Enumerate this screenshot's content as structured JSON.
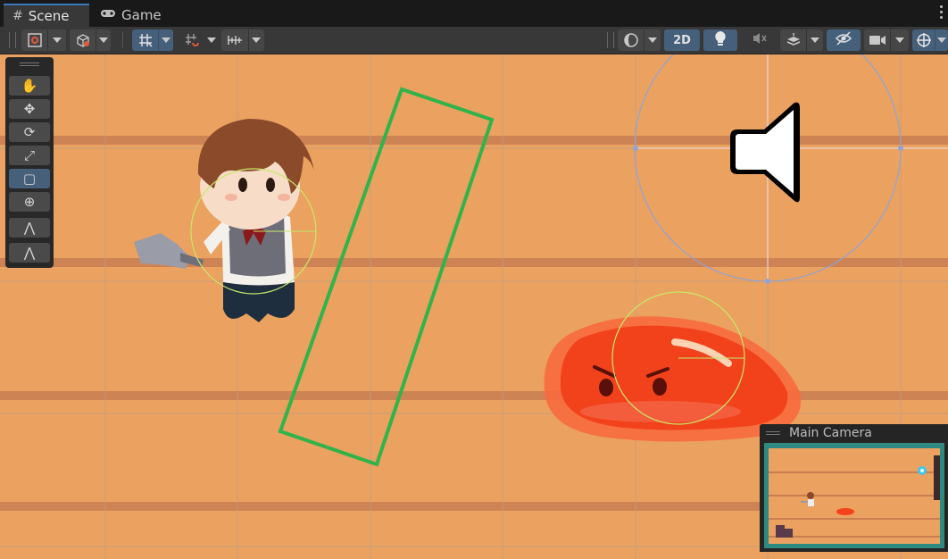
{
  "tabs": {
    "scene": {
      "label": "Scene",
      "icon": "grid-hash-icon"
    },
    "game": {
      "label": "Game",
      "icon": "gamepad-icon"
    }
  },
  "toolbar": {
    "mode_2d_label": "2D",
    "icons": [
      "transform-tool-icon",
      "global-local-cube-icon",
      "grid-snap-icon",
      "increment-snap-icon",
      "grid-ruler-icon",
      "draw-mode-sphere-icon",
      "lighting-bulb-icon",
      "audio-mute-icon",
      "effects-layers-icon",
      "visibility-hidden-icon",
      "camera-icon",
      "gizmos-icon"
    ],
    "accent_color": "#46607c"
  },
  "tools": [
    {
      "name": "hand-tool",
      "icon": "hand-icon",
      "glyph": "✋",
      "active": false
    },
    {
      "name": "move-tool",
      "icon": "move-arrows-icon",
      "glyph": "✥",
      "active": false
    },
    {
      "name": "rotate-tool",
      "icon": "rotate-icon",
      "glyph": "⟳",
      "active": false
    },
    {
      "name": "scale-tool",
      "icon": "scale-icon",
      "glyph": "⤢",
      "active": false
    },
    {
      "name": "rect-tool",
      "icon": "rect-transform-icon",
      "glyph": "▢",
      "active": true
    },
    {
      "name": "transform-tool",
      "icon": "transform-combined-icon",
      "glyph": "⊕",
      "active": false
    },
    {
      "name": "custom-tool-1",
      "icon": "bone-tool-icon",
      "glyph": "⋀",
      "active": false
    },
    {
      "name": "custom-tool-2",
      "icon": "bone-tool-alt-icon",
      "glyph": "⋀",
      "active": false
    }
  ],
  "scene": {
    "background_color": "#eba15f",
    "stripe_color": "#c97e52",
    "collider_color": "#2fb34a",
    "slime_color": "#f2421c",
    "audio_source_icon": "speaker-icon"
  },
  "camera_preview": {
    "title": "Main Camera",
    "frame_color": "#2e8a80"
  }
}
